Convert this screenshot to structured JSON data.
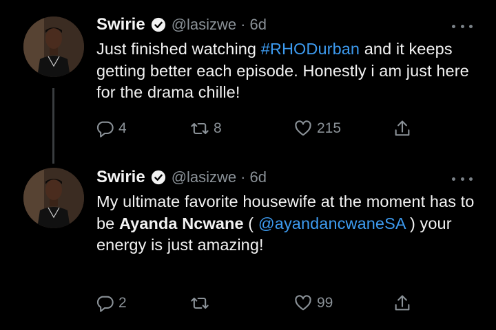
{
  "tweets": [
    {
      "author_name": "Swirie",
      "handle": "@lasizwe",
      "separator": "·",
      "time": "6d",
      "text_before": "Just finished watching ",
      "hashtag": "#RHODurban",
      "text_after": " and it keeps getting better each episode. Honestly i am just here for the drama chille!",
      "replies": "4",
      "retweets": "8",
      "likes": "215",
      "icons": [
        "verified-badge-icon",
        "more-options-icon",
        "reply-icon",
        "retweet-icon",
        "like-icon",
        "share-icon"
      ]
    },
    {
      "author_name": "Swirie",
      "handle": "@lasizwe",
      "separator": "·",
      "time": "6d",
      "text_before": "My ultimate favorite housewife at the moment has to be ",
      "bold_text": "Ayanda Ncwane",
      "paren_open": " ( ",
      "mention": "@ayandancwaneSA",
      "paren_close": " )",
      "text_after": " your energy is just amazing!",
      "replies": "2",
      "retweets": "",
      "likes": "99",
      "icons": [
        "verified-badge-icon",
        "more-options-icon",
        "reply-icon",
        "retweet-icon",
        "like-icon",
        "share-icon"
      ]
    }
  ],
  "colors": {
    "background": "#000000",
    "link": "#3d9bf0",
    "muted": "#8b9298",
    "thread_line": "#3a3d40"
  }
}
